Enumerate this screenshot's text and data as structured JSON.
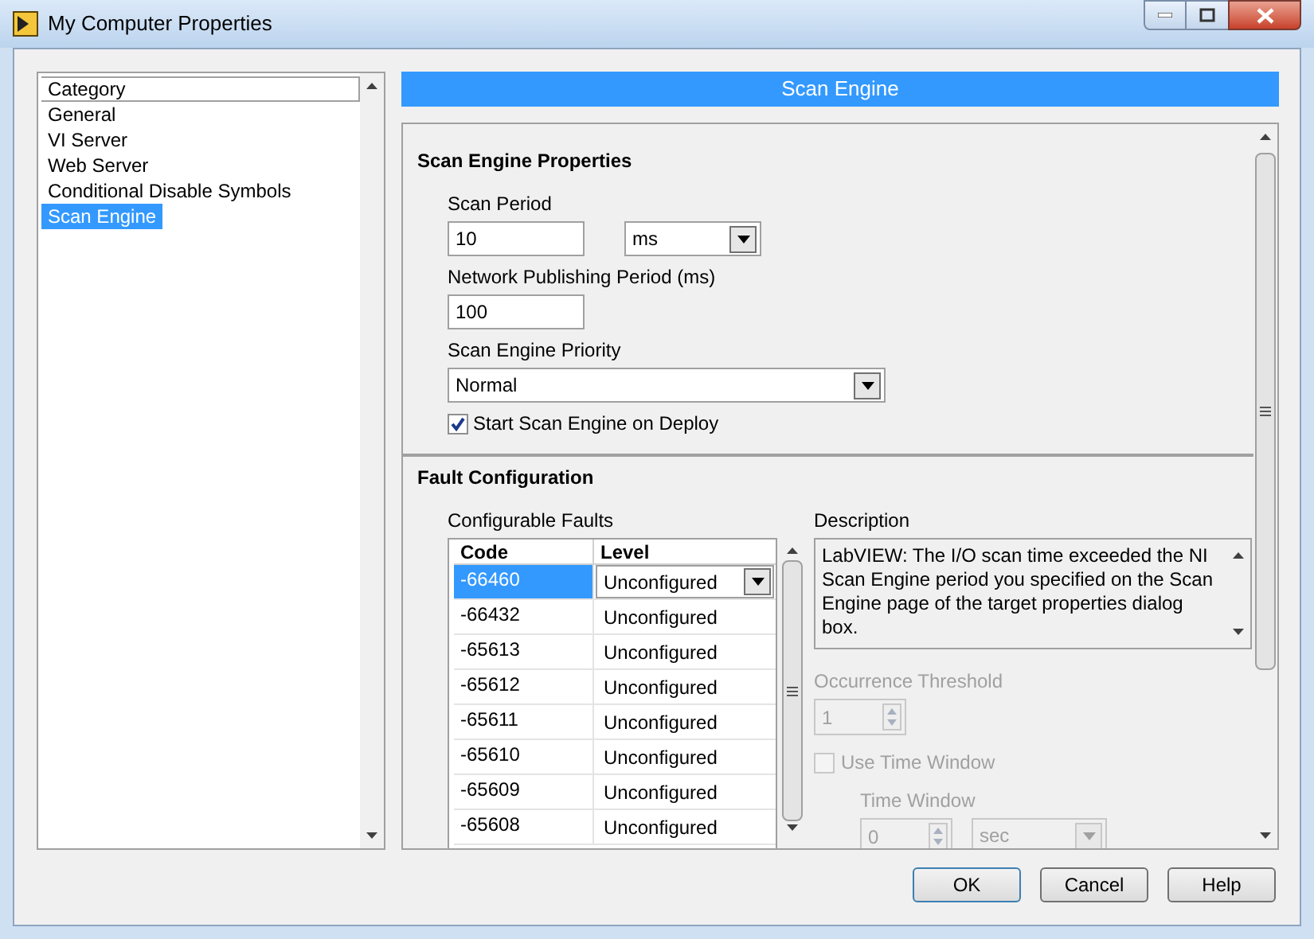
{
  "window": {
    "title": "My Computer Properties"
  },
  "sidebar": {
    "header": "Category",
    "items": [
      {
        "label": "General",
        "selected": false
      },
      {
        "label": "VI Server",
        "selected": false
      },
      {
        "label": "Web Server",
        "selected": false
      },
      {
        "label": "Conditional Disable Symbols",
        "selected": false
      },
      {
        "label": "Scan Engine",
        "selected": true
      }
    ]
  },
  "page_title": "Scan Engine",
  "scan_engine_properties": {
    "heading": "Scan Engine Properties",
    "scan_period": {
      "label": "Scan Period",
      "value": "10",
      "unit": "ms"
    },
    "network_publishing_period": {
      "label": "Network Publishing Period (ms)",
      "value": "100"
    },
    "priority": {
      "label": "Scan Engine Priority",
      "value": "Normal"
    },
    "start_on_deploy": {
      "label": "Start Scan Engine on Deploy",
      "checked": true
    }
  },
  "fault_configuration": {
    "heading": "Fault Configuration",
    "faults": {
      "label": "Configurable Faults",
      "columns": [
        "Code",
        "Level"
      ],
      "rows": [
        {
          "code": "-66460",
          "level": "Unconfigured",
          "selected": true
        },
        {
          "code": "-66432",
          "level": "Unconfigured",
          "selected": false
        },
        {
          "code": "-65613",
          "level": "Unconfigured",
          "selected": false
        },
        {
          "code": "-65612",
          "level": "Unconfigured",
          "selected": false
        },
        {
          "code": "-65611",
          "level": "Unconfigured",
          "selected": false
        },
        {
          "code": "-65610",
          "level": "Unconfigured",
          "selected": false
        },
        {
          "code": "-65609",
          "level": "Unconfigured",
          "selected": false
        },
        {
          "code": "-65608",
          "level": "Unconfigured",
          "selected": false
        }
      ]
    },
    "description": {
      "label": "Description",
      "text": "LabVIEW:  The I/O scan time exceeded the NI Scan Engine period you specified on the Scan Engine page of the target properties dialog box."
    },
    "occurrence_threshold": {
      "label": "Occurrence Threshold",
      "value": "1",
      "disabled": true
    },
    "use_time_window": {
      "label": "Use Time Window",
      "checked": false,
      "disabled": true
    },
    "time_window": {
      "label": "Time Window",
      "value": "0",
      "unit": "sec",
      "disabled": true
    }
  },
  "buttons": [
    "OK",
    "Cancel",
    "Help"
  ]
}
